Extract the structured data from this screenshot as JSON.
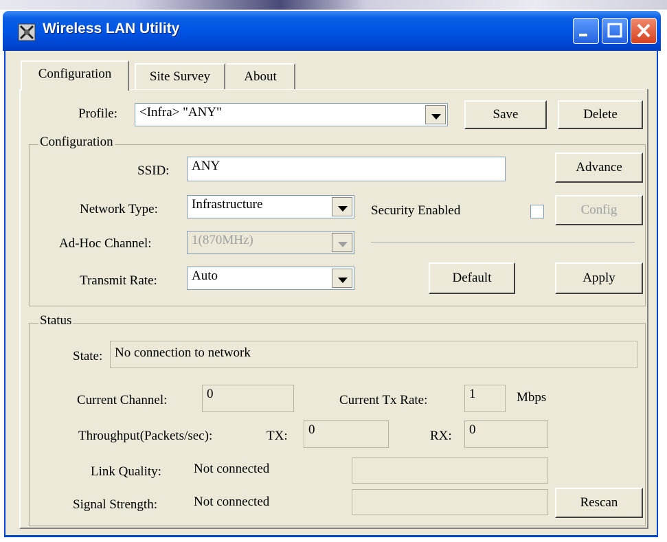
{
  "window": {
    "title": "Wireless LAN Utility"
  },
  "tabs": [
    {
      "label": "Configuration"
    },
    {
      "label": "Site Survey"
    },
    {
      "label": "About"
    }
  ],
  "profile": {
    "label": "Profile:",
    "value": "<Infra> \"ANY\"",
    "save_label": "Save",
    "delete_label": "Delete"
  },
  "configuration": {
    "group_label": "Configuration",
    "ssid_label": "SSID:",
    "ssid_value": "ANY",
    "advance_label": "Advance",
    "network_type_label": "Network Type:",
    "network_type_value": "Infrastructure",
    "security_enabled_label": "Security Enabled",
    "security_enabled_checked": false,
    "config_label": "Config",
    "adhoc_channel_label": "Ad-Hoc Channel:",
    "adhoc_channel_value": "1(870MHz)",
    "transmit_rate_label": "Transmit Rate:",
    "transmit_rate_value": "Auto",
    "default_label": "Default",
    "apply_label": "Apply"
  },
  "status": {
    "group_label": "Status",
    "state_label": "State:",
    "state_value": "No connection to network",
    "current_channel_label": "Current Channel:",
    "current_channel_value": "0",
    "current_tx_rate_label": "Current Tx Rate:",
    "current_tx_rate_value": "1",
    "tx_rate_unit": "Mbps",
    "throughput_label": "Throughput(Packets/sec):",
    "tx_label": "TX:",
    "tx_value": "0",
    "rx_label": "RX:",
    "rx_value": "0",
    "link_quality_label": "Link Quality:",
    "link_quality_value": "Not connected",
    "signal_strength_label": "Signal Strength:",
    "signal_strength_value": "Not connected",
    "rescan_label": "Rescan"
  }
}
